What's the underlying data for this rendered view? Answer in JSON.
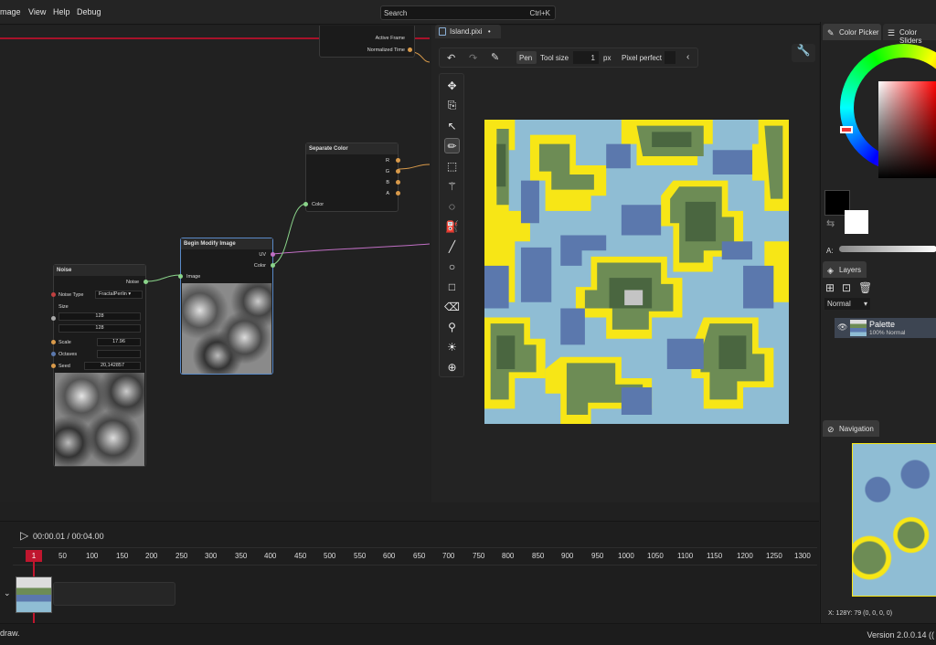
{
  "menu": {
    "items": [
      "mage",
      "View",
      "Help",
      "Debug"
    ]
  },
  "search": {
    "placeholder": "Search",
    "shortcut": "Ctrl+K"
  },
  "graph": {
    "top_node": {
      "row1": "Active Frame",
      "row2": "Normalized Time"
    },
    "separate": {
      "title": "Separate Color",
      "out_r": "R",
      "out_g": "G",
      "out_b": "B",
      "out_a": "A",
      "in_color": "Color"
    },
    "modify": {
      "title": "Begin Modify Image",
      "out_uv": "UV",
      "out_color": "Color",
      "in_image": "Image"
    },
    "noise": {
      "title": "Noise",
      "out_noise": "Noise",
      "type_label": "Noise Type",
      "type_value": "FractalPerlin",
      "size_label": "Size",
      "size_x": "128",
      "size_y": "128",
      "scale_label": "Scale",
      "scale_value": "17.96",
      "octaves_label": "Octaves",
      "seed_label": "Seed",
      "seed_value": "20,142857"
    }
  },
  "document": {
    "tab_name": "Island.pixi",
    "modified_dot": "•"
  },
  "toolbar": {
    "pen": "Pen",
    "tool_size_label": "Tool size",
    "tool_size": "1",
    "px": "px",
    "pixel_perfect": "Pixel perfect"
  },
  "tools": [
    "move-icon",
    "select-layer-icon",
    "arrow-select-icon",
    "pen-icon",
    "rect-select-icon",
    "magic-wand-icon",
    "lasso-icon",
    "fill-bucket-icon",
    "line-icon",
    "ellipse-icon",
    "rectangle-icon",
    "eraser-icon",
    "color-picker-icon",
    "brightness-icon",
    "zoom-icon"
  ],
  "right_panel": {
    "color_picker_tab": "Color Picker",
    "color_sliders_tab": "Color Sliders",
    "alpha_label": "A:",
    "layers_tab": "Layers",
    "blend_mode": "Normal",
    "layer_name": "Palette",
    "layer_info": "100%  Normal",
    "navigation_tab": "Navigation",
    "coords": "X: 128Y: 79   (0, 0, 0, 0)"
  },
  "timeline": {
    "time": "00:00.01 / 00:04.00",
    "current_frame": "1",
    "ticks": [
      "50",
      "100",
      "150",
      "200",
      "250",
      "300",
      "350",
      "400",
      "450",
      "500",
      "550",
      "600",
      "650",
      "700",
      "750",
      "800",
      "850",
      "900",
      "950",
      "1000",
      "1050",
      "1100",
      "1150",
      "1200",
      "1250",
      "1300"
    ]
  },
  "status": {
    "left": "draw.",
    "version": "Version 2.0.0.14 (("
  },
  "colors": {
    "yellow": "#f7e616",
    "light_blue": "#8fbdd4",
    "dark_blue": "#5b78ad",
    "green": "#6d8c55",
    "light_green": "#8ba86a",
    "dark_green": "#4a6640",
    "gray": "#c4c4c4",
    "accent_red": "#a8122a"
  }
}
